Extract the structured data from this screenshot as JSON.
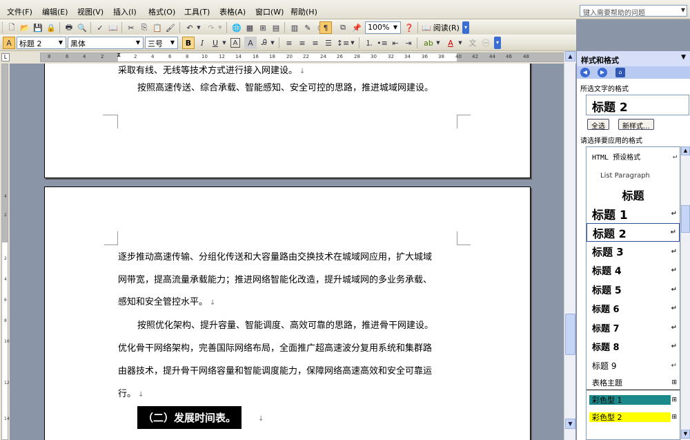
{
  "menu": {
    "items": [
      "文件(F)",
      "编辑(E)",
      "视图(V)",
      "插入(I)",
      "格式(O)",
      "工具(T)",
      "表格(A)",
      "窗口(W)",
      "帮助(H)"
    ],
    "help_placeholder": "键入需要帮助的问题"
  },
  "toolbar": {
    "zoom": "100%",
    "read_label": "阅读(R)",
    "style": "标题 2",
    "font": "黑体",
    "size": "三号",
    "bold_label": "B",
    "italic_label": "I",
    "underline_label": "U",
    "charborder_label": "A",
    "charshade_label": "A",
    "fontcolor_label": "A"
  },
  "ruler": {
    "numbers": [
      "8",
      "6",
      "4",
      "2",
      "2",
      "4",
      "6",
      "8",
      "10",
      "12",
      "14",
      "16",
      "18",
      "20",
      "22",
      "24",
      "26",
      "28",
      "30",
      "32",
      "34",
      "36",
      "38",
      "40",
      "42",
      "44",
      "46",
      "48"
    ],
    "vnumbers": [
      "4",
      "2",
      "2",
      "4",
      "6",
      "8",
      "10",
      "12",
      "14"
    ]
  },
  "document": {
    "page1_line1": "采取有线、无线等技术方式进行接入网建设。",
    "page1_line2": "按照高速传送、综合承载、智能感知、安全可控的思路，推进城域网建设。",
    "p2_l1": "逐步推动高速传输、分组化传送和大容量路由交换技术在城域网应用，扩大城域",
    "p2_l2": "网带宽，提高流量承载能力；推进网络智能化改造，提升城域网的多业务承载、",
    "p2_l3": "感知和安全管控水平。",
    "p2_l4": "按照优化架构、提升容量、智能调度、高效可靠的思路，推进骨干网建设。",
    "p2_l5": "优化骨干网络架构，完善国际网络布局，全面推广超高速波分复用系统和集群路",
    "p2_l6": "由器技术，提升骨干网络容量和智能调度能力，保障网络高速高效和安全可靠运",
    "p2_l7": "行。",
    "heading": "（二）发展时间表。",
    "para_mark": "↓"
  },
  "pane": {
    "title": "样式和格式",
    "selected_label": "所选文字的格式",
    "current_style": "标题 2",
    "select_all": "全选",
    "new_style": "新样式...",
    "apply_label": "请选择要应用的格式",
    "styles": [
      {
        "name": "HTML 预设格式",
        "mark": "↵"
      },
      {
        "name": "List Paragraph",
        "mark": ""
      },
      {
        "name": "标题",
        "mark": ""
      },
      {
        "name": "标题 1",
        "mark": "↵"
      },
      {
        "name": "标题 2",
        "mark": "↵"
      },
      {
        "name": "标题 3",
        "mark": "↵"
      },
      {
        "name": "标题 4",
        "mark": "↵"
      },
      {
        "name": "标题 5",
        "mark": "↵"
      },
      {
        "name": "标题 6",
        "mark": "↵"
      },
      {
        "name": "标题 7",
        "mark": "↵"
      },
      {
        "name": "标题 8",
        "mark": "↵"
      },
      {
        "name": "标题 9",
        "mark": "↵"
      },
      {
        "name": "表格主题",
        "mark": "⊞"
      },
      {
        "name": "彩色型 1",
        "mark": "⊞"
      },
      {
        "name": "彩色型 2",
        "mark": "⊞"
      }
    ],
    "colors": {
      "teal": "#1c8a8a",
      "yellow": "#ffff00"
    }
  }
}
